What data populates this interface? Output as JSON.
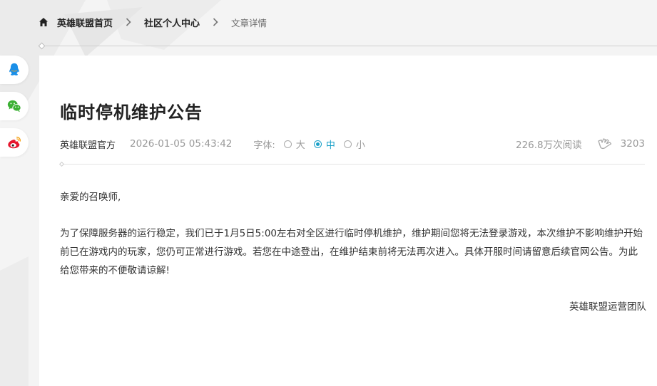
{
  "breadcrumb": {
    "home": "英雄联盟首页",
    "community": "社区个人中心",
    "current": "文章详情"
  },
  "share": {
    "icons": [
      "qq-icon",
      "wechat-icon",
      "weibo-icon"
    ]
  },
  "article": {
    "title": "临时停机维护公告",
    "author": "英雄联盟官方",
    "date": "2026-01-05 05:43:42",
    "font_label": "字体:",
    "font_options": [
      "大",
      "中",
      "小"
    ],
    "font_selected": "中",
    "views": "226.8万次阅读",
    "likes": "3203",
    "greeting": "亲爱的召唤师,",
    "paragraph": "为了保障服务器的运行稳定，我们已于1月5日5:00左右对全区进行临时停机维护，维护期间您将无法登录游戏，本次维护不影响维护开始前已在游戏内的玩家，您仍可正常进行游戏。若您在中途登出，在维护结束前将无法再次进入。具体开服时间请留意后续官网公告。为此给您带来的不便敬请谅解!",
    "signature": "英雄联盟运营团队"
  },
  "colors": {
    "accent": "#1aa0c8",
    "qq": "#1a8fe8",
    "wechat": "#3cb034",
    "weibo": "#e6162d"
  }
}
